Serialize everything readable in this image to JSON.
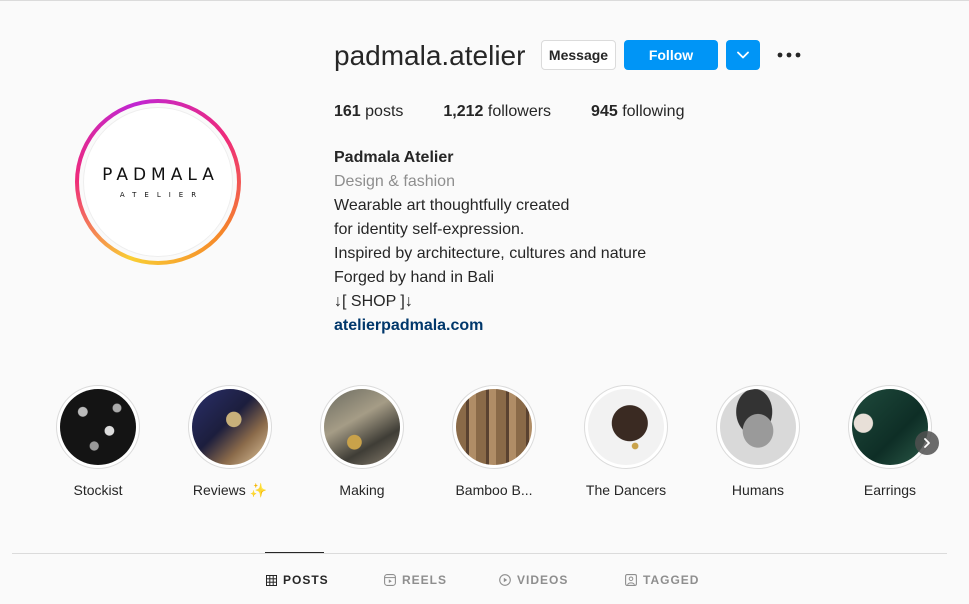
{
  "profile": {
    "username": "padmala.atelier",
    "avatar_logo_main": "PADMALA",
    "avatar_logo_sub": "ATELIER",
    "message_label": "Message",
    "follow_label": "Follow",
    "stats": {
      "posts_count": "161",
      "posts_label": "posts",
      "followers_count": "1,212",
      "followers_label": "followers",
      "following_count": "945",
      "following_label": "following"
    },
    "bio": {
      "name": "Padmala Atelier",
      "category": "Design & fashion",
      "line1": "Wearable art thoughtfully created",
      "line2": "for identity self-expression.",
      "line3": "Inspired by architecture, cultures and nature",
      "line4": "Forged by hand in Bali",
      "line5": "↓[ SHOP ]↓",
      "link": "atelierpadmala.com"
    }
  },
  "highlights": [
    {
      "label": "Stockist"
    },
    {
      "label": "Reviews ✨"
    },
    {
      "label": "Making"
    },
    {
      "label": "Bamboo B..."
    },
    {
      "label": "The Dancers"
    },
    {
      "label": "Humans"
    },
    {
      "label": "Earrings"
    }
  ],
  "tabs": [
    {
      "label": "POSTS",
      "icon": "grid-icon",
      "active": true
    },
    {
      "label": "REELS",
      "icon": "reels-icon",
      "active": false
    },
    {
      "label": "VIDEOS",
      "icon": "video-icon",
      "active": false
    },
    {
      "label": "TAGGED",
      "icon": "tagged-icon",
      "active": false
    }
  ],
  "colors": {
    "follow_blue": "#0095f6",
    "link": "#00376b",
    "muted": "#8e8e8e"
  }
}
